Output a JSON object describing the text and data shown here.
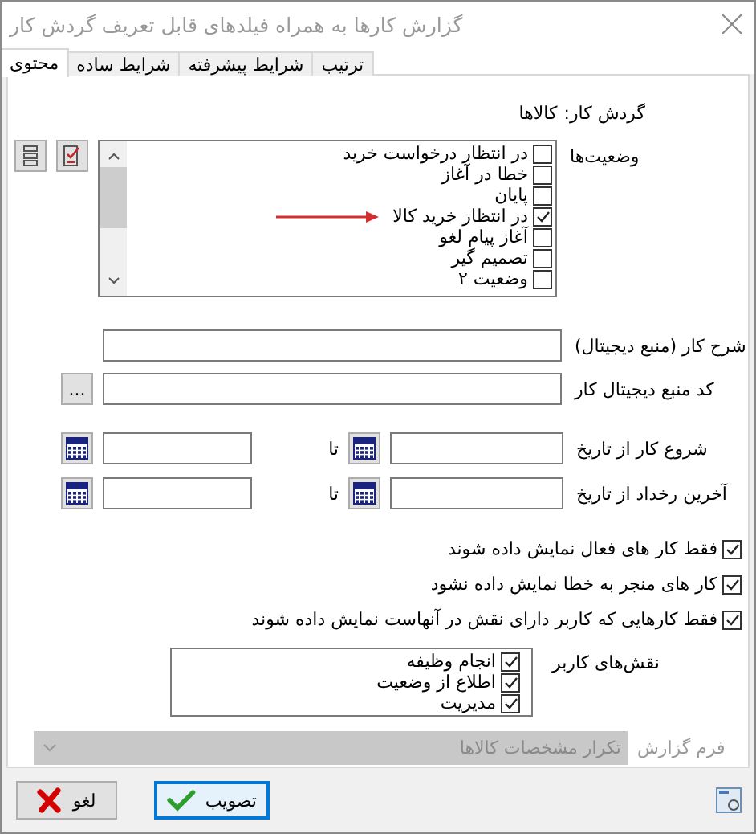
{
  "window": {
    "title": "گزارش کارها به همراه فیلدهای قابل تعریف گردش کار"
  },
  "tabs": [
    {
      "label": "ترتیب",
      "selected": false
    },
    {
      "label": "شرایط پیشرفته",
      "selected": false
    },
    {
      "label": "شرایط ساده",
      "selected": false
    },
    {
      "label": "محتوی",
      "selected": true
    }
  ],
  "workflow": {
    "label": "گردش کار:",
    "value": "کالاها"
  },
  "statuses": {
    "label": "وضعیت‌ها",
    "items": [
      {
        "label": "در انتظار درخواست خرید",
        "checked": false,
        "annotated": false
      },
      {
        "label": "خطا در آغاز",
        "checked": false,
        "annotated": false
      },
      {
        "label": "پایان",
        "checked": false,
        "annotated": false
      },
      {
        "label": "در انتظار خرید کالا",
        "checked": true,
        "annotated": true
      },
      {
        "label": "آغاز پیام لغو",
        "checked": false,
        "annotated": false
      },
      {
        "label": "تصمیم گیر",
        "checked": false,
        "annotated": false
      },
      {
        "label": "وضعیت ۲",
        "checked": false,
        "annotated": false
      }
    ]
  },
  "fields": [
    {
      "label": "شرح کار (منبع دیجیتال)",
      "kind": "text"
    },
    {
      "label": "کد منبع دیجیتال کار",
      "kind": "browse",
      "button": "..."
    }
  ],
  "date_ranges": [
    {
      "label": "شروع کار از تاریخ",
      "to_label": "تا"
    },
    {
      "label": "آخرین رخداد از تاریخ",
      "to_label": "تا"
    }
  ],
  "options": [
    {
      "label": "فقط کار های فعال نمایش داده شوند",
      "checked": true
    },
    {
      "label": "کار های منجر به خطا نمایش داده نشود",
      "checked": true
    },
    {
      "label": "فقط کارهایی که کاربر دارای نقش در آنهاست نمایش داده شوند",
      "checked": true
    }
  ],
  "user_roles": {
    "label": "نقش‌های کاربر",
    "items": [
      {
        "label": "انجام وظیفه",
        "checked": true
      },
      {
        "label": "اطلاع از وضعیت",
        "checked": true
      },
      {
        "label": "مدیریت",
        "checked": true
      }
    ]
  },
  "report_form": {
    "label": "فرم گزارش",
    "value": "تکرار مشخصات کالاها",
    "disabled": true
  },
  "buttons": [
    {
      "label": "تصویب",
      "kind": "ok",
      "focused": true
    },
    {
      "label": "لغو",
      "kind": "cancel",
      "focused": false
    }
  ]
}
